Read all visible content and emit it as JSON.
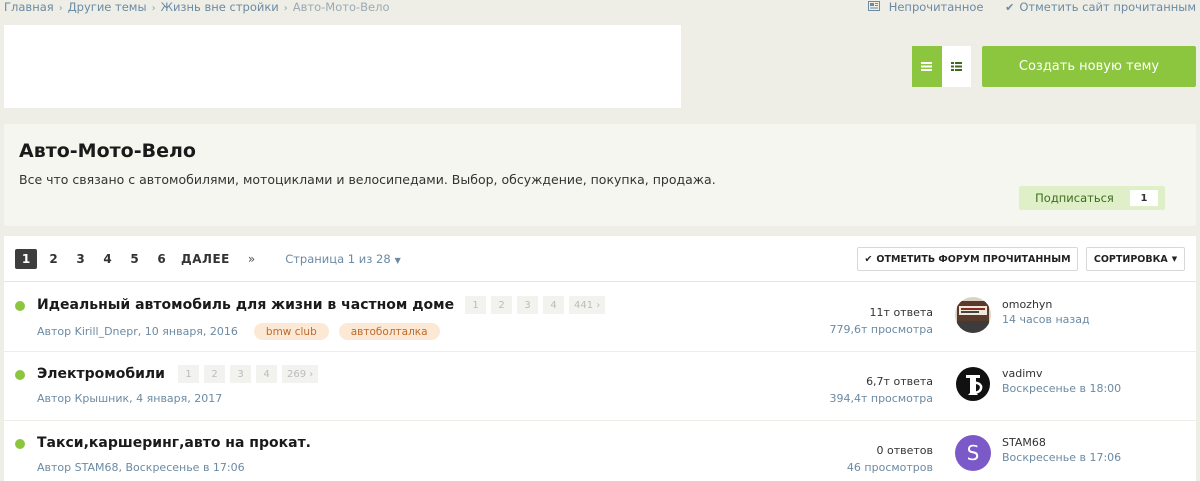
{
  "breadcrumb": {
    "items": [
      "Главная",
      "Другие темы",
      "Жизнь вне стройки"
    ],
    "current": "Авто-Мото-Вело",
    "separator": "›"
  },
  "toplinks": {
    "unread": "Непрочитанное",
    "mark_site_read": "Отметить сайт прочитанным"
  },
  "actions": {
    "new_topic": "Создать новую тему"
  },
  "forum": {
    "title": "Авто-Мото-Вело",
    "description": "Все что связано с автомобилями, мотоциклами и велосипедами. Выбор, обсуждение, покупка, продажа.",
    "subscribe_label": "Подписаться",
    "subscribe_count": "1"
  },
  "pagination": {
    "pages": [
      "1",
      "2",
      "3",
      "4",
      "5",
      "6"
    ],
    "current": "1",
    "next": "ДАЛЕЕ",
    "last": "»",
    "jump": "Страница 1 из 28"
  },
  "list_actions": {
    "mark_forum_read": "ОТМЕТИТЬ ФОРУМ ПРОЧИТАННЫМ",
    "sort": "СОРТИРОВКА"
  },
  "topics": [
    {
      "title": "Идеальный автомобиль для жизни в частном доме",
      "pages": [
        "1",
        "2",
        "3",
        "4",
        "441 ›"
      ],
      "meta": "Автор Kirill_Dnepr, 10 января, 2016",
      "tags": [
        "bmw club",
        "автоболталка"
      ],
      "replies": "11т ответа",
      "views": "779,6т просмотра",
      "last_user": "omozhyn",
      "last_time": "14 часов назад",
      "avatar": "photo-avatar-icon"
    },
    {
      "title": "Электромобили",
      "pages": [
        "1",
        "2",
        "3",
        "4",
        "269 ›"
      ],
      "meta": "Автор Крышник, 4 января, 2017",
      "tags": [],
      "replies": "6,7т ответа",
      "views": "394,4т просмотра",
      "last_user": "vadimv",
      "last_time": "Воскресенье в 18:00",
      "avatar": "letter-avatar-icon"
    },
    {
      "title": "Такси,каршеринг,авто на прокат.",
      "pages": [],
      "meta": "Автор STAM68, Воскресенье в 17:06",
      "tags": [],
      "replies": "0 ответов",
      "views": "46 просмотров",
      "last_user": "STAM68",
      "last_time": "Воскресенье в 17:06",
      "avatar_letter": "S",
      "avatar_color": "#7b59c9"
    }
  ],
  "colors": {
    "accent": "#8cc63f",
    "link": "#6b8aa3"
  }
}
